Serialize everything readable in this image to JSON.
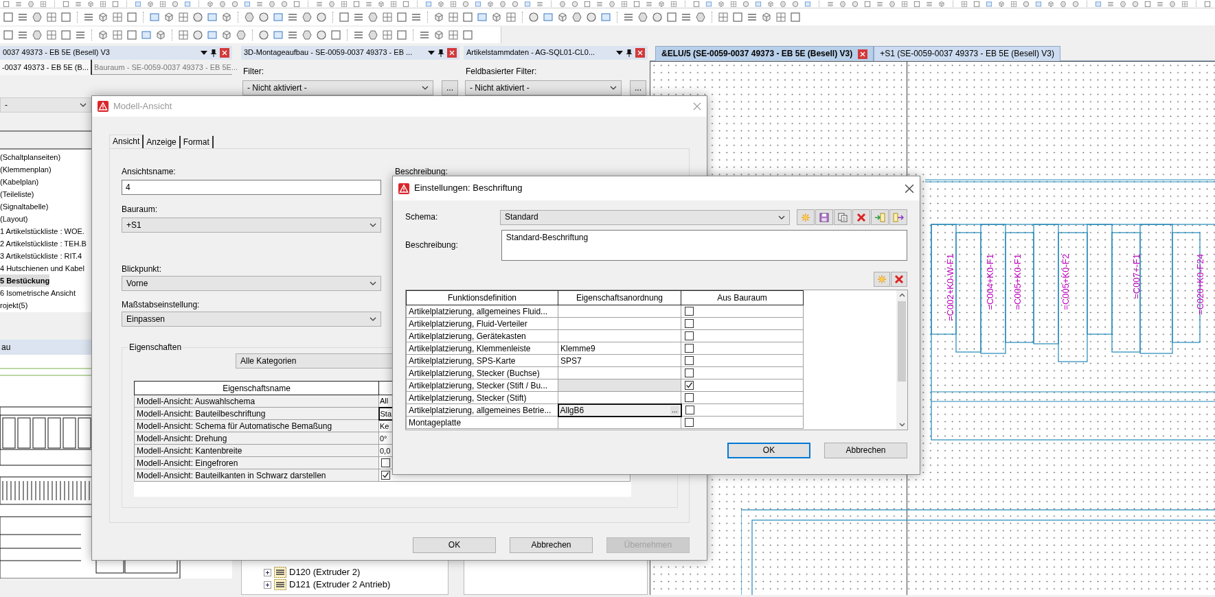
{
  "left_panel": {
    "title": "0037 49373 - EB 5E (Besell) V3",
    "tabs": [
      {
        "label": "-0037 49373 - EB 5E (B...",
        "selected": true
      },
      {
        "label": "Bauraum - SE-0059-0037 49373 - EB 5E...",
        "selected": false
      }
    ],
    "selector_value": "-",
    "items": [
      {
        "label": "(Schaltplanseiten)",
        "selected": false
      },
      {
        "label": "(Klemmenplan)",
        "selected": false
      },
      {
        "label": "(Kabelplan)",
        "selected": false
      },
      {
        "label": "(Teileliste)",
        "selected": false
      },
      {
        "label": "(Signaltabelle)",
        "selected": false
      },
      {
        "label": "(Layout)",
        "selected": false
      },
      {
        "label": "1 Artikelstückliste : WOE.",
        "selected": false
      },
      {
        "label": "2 Artikelstückliste : TEH.B",
        "selected": false
      },
      {
        "label": "3 Artikelstückliste : RIT.4",
        "selected": false
      },
      {
        "label": "4 Hutschienen und Kabel",
        "selected": false
      },
      {
        "label": "5 Bestückung",
        "selected": true
      },
      {
        "label": "6 Isometrische Ansicht",
        "selected": false
      },
      {
        "label": "rojekt(5)",
        "selected": false
      }
    ],
    "lower_title": "au"
  },
  "middle_panel": {
    "title": "3D-Montageaufbau - SE-0059-0037 49373 - EB ...",
    "filter_label": "Filter:",
    "filter_value": "- Nicht aktiviert -",
    "filter_button": "...",
    "tree": [
      {
        "label": "D120 (Extruder 2)",
        "expanded": false
      },
      {
        "label": "D121 (Extruder 2 Antrieb)",
        "expanded": false
      }
    ]
  },
  "right_panel": {
    "title": "Artikelstammdaten - AG-SQL01-CL0...",
    "filter_label": "Feldbasierter Filter:",
    "filter_value": "- Nicht aktiviert -",
    "filter_button": "..."
  },
  "document_tabs": [
    {
      "label": "&ELU/5 (SE-0059-0037 49373 - EB 5E (Besell) V3)",
      "selected": true
    },
    {
      "label": "+S1 (SE-0059-0037 49373 - EB 5E (Besell) V3)",
      "selected": false
    }
  ],
  "drawing_labels": [
    "=C002+K0-W-F1",
    "=C004+K0-F1",
    "=C005+K0-F1",
    "=C005+K0-F2",
    "=C007+-F1",
    "=C020+K0-F24"
  ],
  "model_dialog": {
    "title": "Modell-Ansicht",
    "tabs": [
      {
        "label": "Ansicht",
        "selected": true
      },
      {
        "label": "Anzeige",
        "selected": false
      },
      {
        "label": "Format",
        "selected": false
      }
    ],
    "view_name_label": "Ansichtsname:",
    "view_name": "4",
    "description_label": "Beschreibung:",
    "space_label": "Bauraum:",
    "space": "+S1",
    "viewpoint_label": "Blickpunkt:",
    "viewpoint": "Vorne",
    "scale_label": "Maßstabseinstellung:",
    "scale": "Einpassen",
    "properties": {
      "title": "Eigenschaften",
      "category": "Alle Kategorien",
      "column": "Eigenschaftsname",
      "rows": [
        {
          "kind": "text",
          "name": "Modell-Ansicht: Auswahlschema",
          "value": "All",
          "focused": false
        },
        {
          "kind": "text",
          "name": "Modell-Ansicht: Bauteilbeschriftung",
          "value": "Sta",
          "focused": true
        },
        {
          "kind": "text",
          "name": "Modell-Ansicht: Schema für Automatische Bemaßung",
          "value": "Ke",
          "focused": false
        },
        {
          "kind": "text",
          "name": "Modell-Ansicht: Drehung",
          "value": "0°",
          "focused": false
        },
        {
          "kind": "text",
          "name": "Modell-Ansicht: Kantenbreite",
          "value": "0,0",
          "focused": false
        },
        {
          "kind": "checkbox",
          "name": "Modell-Ansicht: Eingefroren",
          "checked": false,
          "focused": false
        },
        {
          "kind": "checkbox",
          "name": "Modell-Ansicht: Bauteilkanten in Schwarz darstellen",
          "checked": true,
          "focused": false
        }
      ]
    },
    "buttons": [
      {
        "label": "OK",
        "disabled": false
      },
      {
        "label": "Abbrechen",
        "disabled": false
      },
      {
        "label": "Übernehmen",
        "disabled": true
      }
    ]
  },
  "label_dialog": {
    "title": "Einstellungen: Beschriftung",
    "scheme_label": "Schema:",
    "scheme": "Standard",
    "description_label": "Beschreibung:",
    "description": "Standard-Beschriftung",
    "columns": [
      "Funktionsdefinition",
      "Eigenschaftsanordnung",
      "Aus Bauraum"
    ],
    "rows": [
      {
        "function": "Artikelplatzierung, allgemeines Fluid...",
        "from_space": false,
        "disabled": false,
        "editing": false
      },
      {
        "function": "Artikelplatzierung, Fluid-Verteiler",
        "from_space": false,
        "disabled": false,
        "editing": false
      },
      {
        "function": "Artikelplatzierung, Gerätekasten",
        "from_space": false,
        "disabled": false,
        "editing": false
      },
      {
        "function": "Artikelplatzierung, Klemmenleiste",
        "assignment": "Klemme9",
        "from_space": false,
        "disabled": false,
        "editing": false
      },
      {
        "function": "Artikelplatzierung, SPS-Karte",
        "assignment": "SPS7",
        "from_space": false,
        "disabled": false,
        "editing": false
      },
      {
        "function": "Artikelplatzierung, Stecker (Buchse)",
        "from_space": false,
        "disabled": false,
        "editing": false
      },
      {
        "function": "Artikelplatzierung, Stecker (Stift / Bu...",
        "from_space": true,
        "disabled": true,
        "editing": false
      },
      {
        "function": "Artikelplatzierung, Stecker (Stift)",
        "from_space": false,
        "disabled": false,
        "editing": false
      },
      {
        "function": "Artikelplatzierung, allgemeines Betrie...",
        "assignment": "AllgB6",
        "from_space": false,
        "disabled": false,
        "editing": true
      },
      {
        "function": "Montageplatte",
        "from_space": false,
        "disabled": false,
        "editing": false
      }
    ],
    "browse_button": "...",
    "buttons": [
      {
        "label": "OK",
        "default": true
      },
      {
        "label": "Abbrechen",
        "default": false
      }
    ]
  }
}
